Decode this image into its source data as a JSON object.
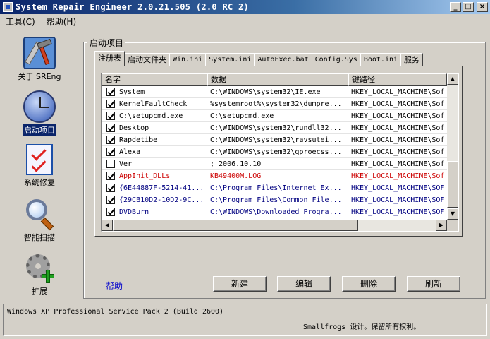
{
  "window": {
    "title": "System Repair Engineer 2.0.21.505 (2.0 RC 2)"
  },
  "menu": [
    {
      "label": "工具(C)"
    },
    {
      "label": "帮助(H)"
    }
  ],
  "sidebar": {
    "items": [
      {
        "label": "关于 SREng",
        "icon": "toolbox-icon"
      },
      {
        "label": "启动项目",
        "icon": "clock-icon",
        "selected": true
      },
      {
        "label": "系统修复",
        "icon": "checklist-icon"
      },
      {
        "label": "智能扫描",
        "icon": "magnifier-icon"
      },
      {
        "label": "扩展",
        "icon": "gear-plus-icon"
      }
    ]
  },
  "group": {
    "title": "启动项目"
  },
  "tabs": [
    {
      "label": "注册表",
      "active": true
    },
    {
      "label": "启动文件夹"
    },
    {
      "label": "Win.ini"
    },
    {
      "label": "System.ini"
    },
    {
      "label": "AutoExec.bat"
    },
    {
      "label": "Config.Sys"
    },
    {
      "label": "Boot.ini"
    },
    {
      "label": "服务"
    }
  ],
  "list": {
    "columns": [
      "名字",
      "数据",
      "键路径"
    ],
    "rows": [
      {
        "name": "System",
        "data": "C:\\WINDOWS\\system32\\IE.exe",
        "path": "HKEY_LOCAL_MACHINE\\Sof",
        "checked": true,
        "color": "#000000"
      },
      {
        "name": "KernelFaultCheck",
        "data": "%systemroot%\\system32\\dumpre...",
        "path": "HKEY_LOCAL_MACHINE\\Sof",
        "checked": true,
        "color": "#000000"
      },
      {
        "name": "C:\\setupcmd.exe",
        "data": "C:\\setupcmd.exe",
        "path": "HKEY_LOCAL_MACHINE\\Sof",
        "checked": true,
        "color": "#000000"
      },
      {
        "name": "Desktop",
        "data": "C:\\WINDOWS\\system32\\rundll32...",
        "path": "HKEY_LOCAL_MACHINE\\Sof",
        "checked": true,
        "color": "#000000"
      },
      {
        "name": "Rapdetibe",
        "data": "C:\\WINDOWS\\system32\\ravsutei...",
        "path": "HKEY_LOCAL_MACHINE\\Sof",
        "checked": true,
        "color": "#000000"
      },
      {
        "name": "Alexa",
        "data": "C:\\WINDOWS\\system32\\qproecss...",
        "path": "HKEY_LOCAL_MACHINE\\Sof",
        "checked": true,
        "color": "#000000"
      },
      {
        "name": "Ver",
        "data": "; 2006.10.10",
        "path": "HKEY_LOCAL_MACHINE\\Sof",
        "checked": false,
        "color": "#000000"
      },
      {
        "name": "AppInit_DLLs",
        "data": "KB49400M.LOG",
        "path": "HKEY_LOCAL_MACHINE\\Sof",
        "checked": true,
        "color": "#cc0000"
      },
      {
        "name": "{6E44887F-5214-41...",
        "data": "C:\\Program Files\\Internet Ex...",
        "path": "HKEY_LOCAL_MACHINE\\SOF",
        "checked": true,
        "color": "#000080"
      },
      {
        "name": "{29CB10D2-10D2-9C...",
        "data": "C:\\Program Files\\Common File...",
        "path": "HKEY_LOCAL_MACHINE\\SOF",
        "checked": true,
        "color": "#000080"
      },
      {
        "name": "DVDBurn",
        "data": "C:\\WINDOWS\\Downloaded Progra...",
        "path": "HKEY_LOCAL_MACHINE\\SOF",
        "checked": true,
        "color": "#000080"
      }
    ]
  },
  "actions": {
    "help": "帮助",
    "new": "新建",
    "edit": "编辑",
    "delete": "删除",
    "refresh": "刷新"
  },
  "status": {
    "os": "Windows XP Professional Service Pack 2 (Build 2600)",
    "copyright": "Smallfrogs 设计。保留所有权利。"
  },
  "colors": {
    "title_start": "#0a246a",
    "title_end": "#a6caf0",
    "selection": "#0a246a",
    "danger_row": "#cc0000",
    "guid_row": "#000080"
  }
}
